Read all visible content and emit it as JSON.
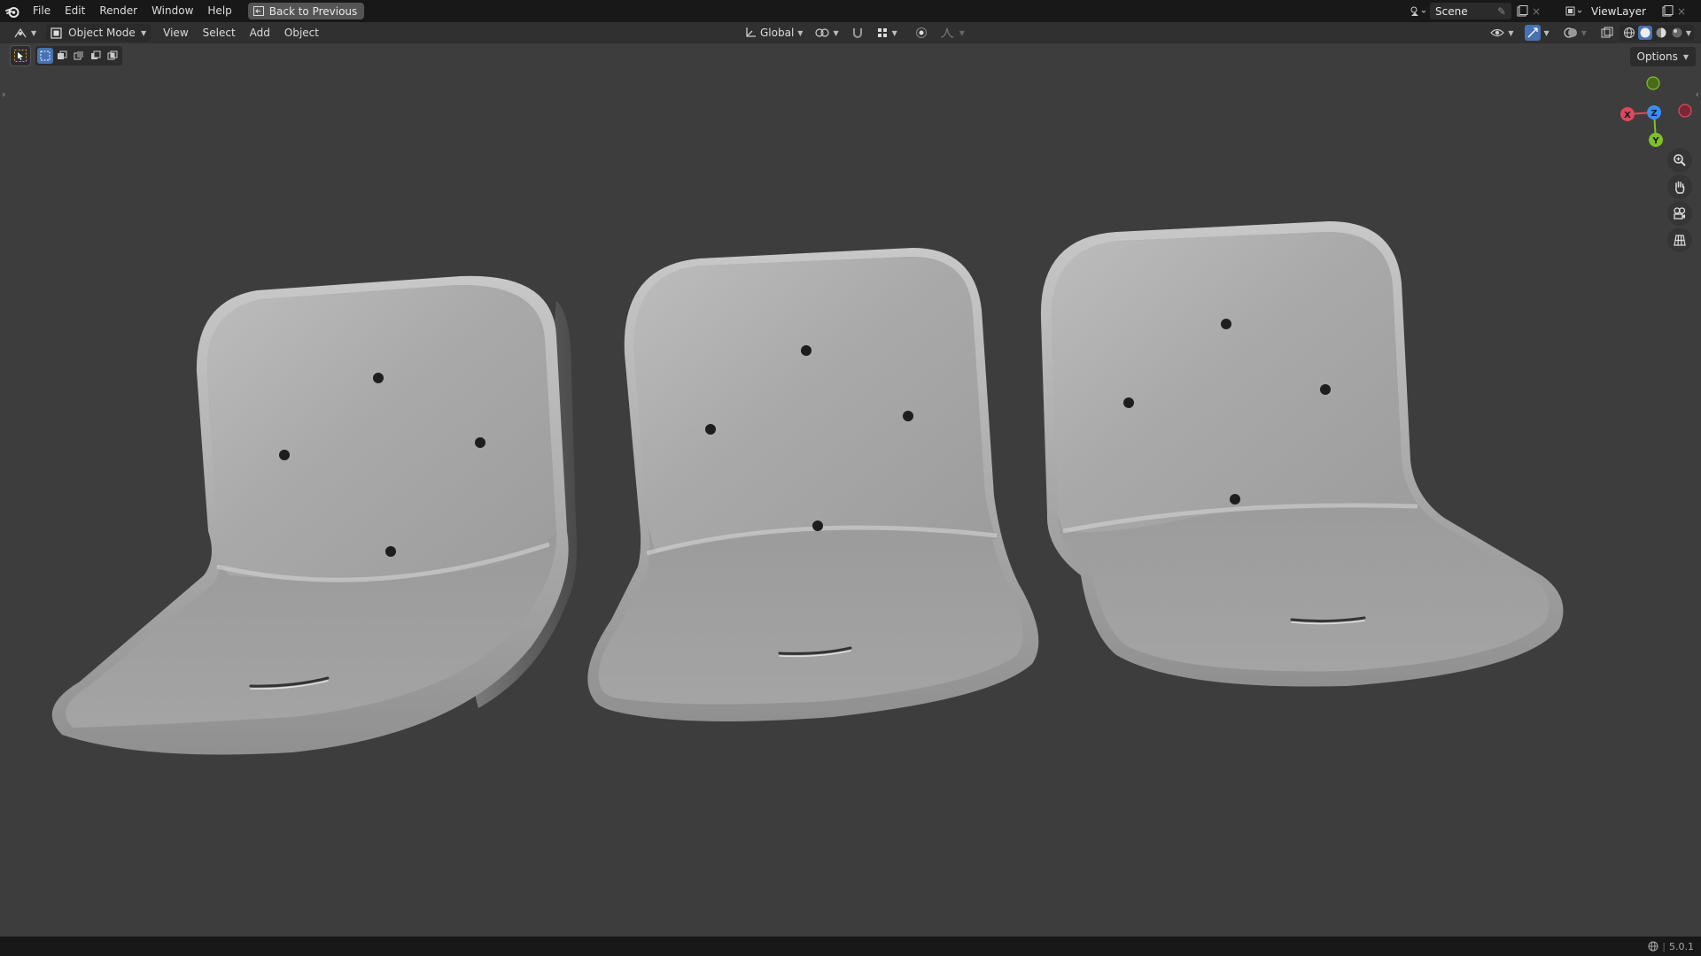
{
  "topbar": {
    "menus": [
      "File",
      "Edit",
      "Render",
      "Window",
      "Help"
    ],
    "back_button": "Back to Previous",
    "scene_name": "Scene",
    "view_layer_name": "ViewLayer"
  },
  "header": {
    "mode": "Object Mode",
    "menus": [
      "View",
      "Select",
      "Add",
      "Object"
    ],
    "transform_orientation": "Global"
  },
  "options_label": "Options",
  "gizmo": {
    "axes": [
      "X",
      "Y",
      "Z"
    ],
    "colors": {
      "x": "#e0475e",
      "y": "#7fbf2a",
      "z": "#3a8ff0"
    }
  },
  "nav_icons": [
    "zoom-icon",
    "hand-icon",
    "camera-icon",
    "ortho-grid-icon"
  ],
  "status": {
    "version": "5.0.1"
  },
  "viewport": {
    "background": "#3d3d3d",
    "objects": [
      "seat-shell-left",
      "seat-shell-middle",
      "seat-shell-right"
    ]
  }
}
